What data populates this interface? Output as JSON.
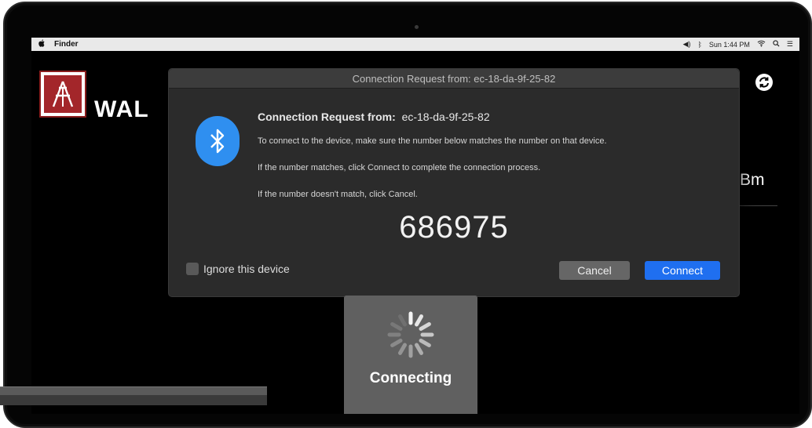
{
  "menubar": {
    "apple": "",
    "app_name": "Finder",
    "status_clock": "Sun 1:44 PM",
    "icons": [
      "volume-icon",
      "bluetooth-icon",
      "wifi-icon",
      "search-icon",
      "list-icon"
    ]
  },
  "app": {
    "title": "WAL",
    "partial_text": "Bm",
    "logo_letter": "A"
  },
  "dialog": {
    "window_title": "Connection Request from: ec-18-da-9f-25-82",
    "heading_label": "Connection Request from:",
    "heading_value": "ec-18-da-9f-25-82",
    "line1": "To connect to the device, make sure the number below matches the number on that device.",
    "line2": "If the number matches, click Connect to complete the connection process.",
    "line3": "If the number doesn't match, click Cancel.",
    "pair_code": "686975",
    "ignore_label": "Ignore this device",
    "cancel_label": "Cancel",
    "connect_label": "Connect",
    "accent_color": "#1f6ff0",
    "icon_color": "#2f8ff0"
  },
  "connecting": {
    "label": "Connecting"
  }
}
